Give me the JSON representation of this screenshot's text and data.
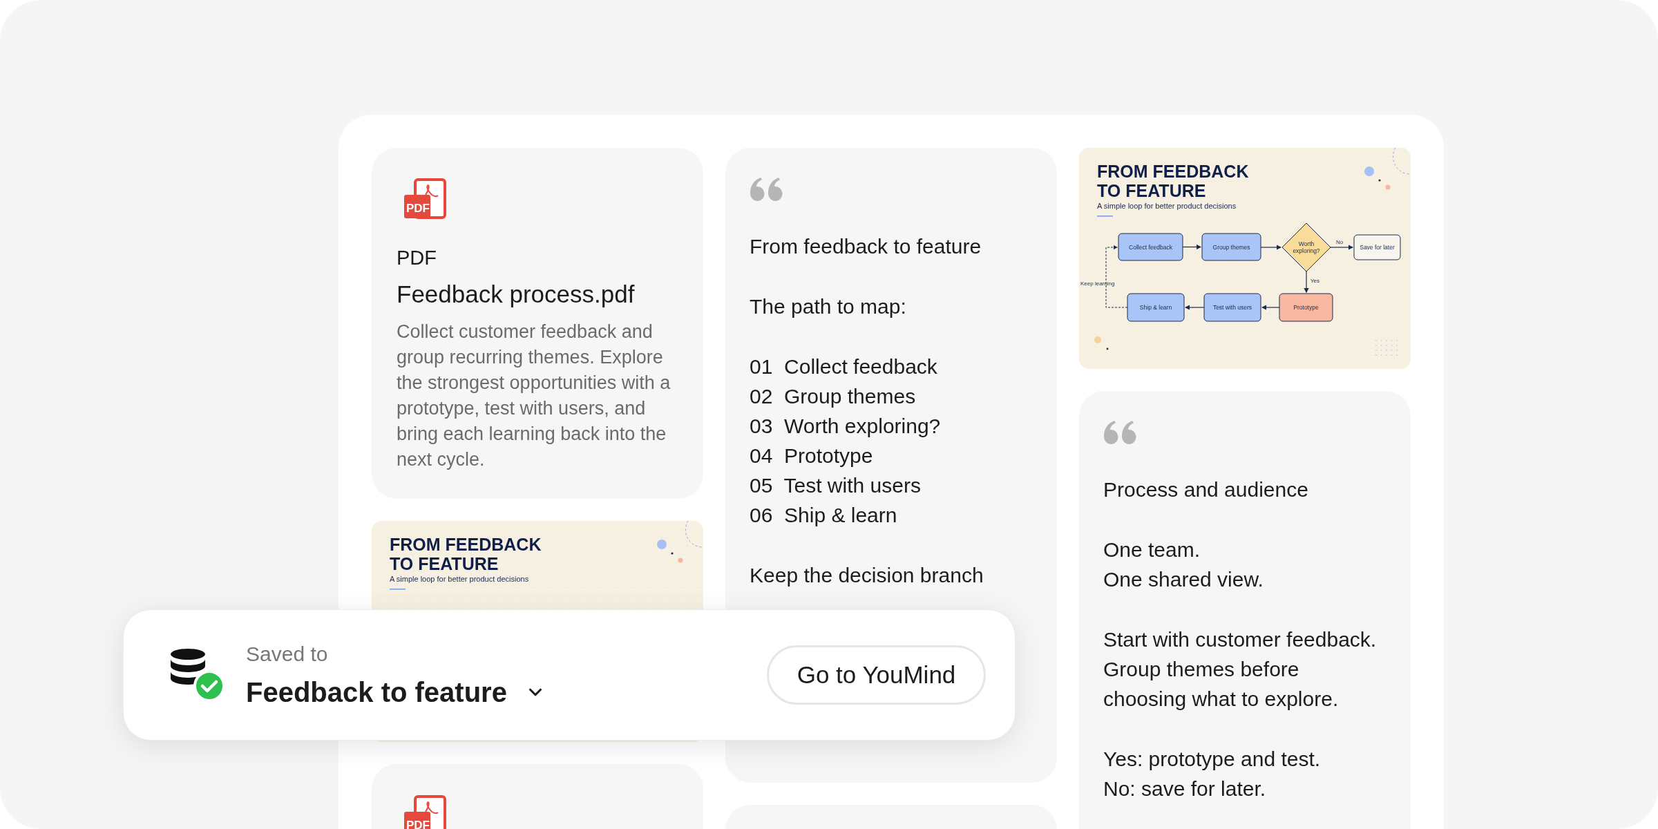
{
  "columns": [
    {
      "cards": [
        {
          "kind": "file",
          "icon_label": "PDF",
          "type_label": "PDF",
          "title": "Feedback process.pdf",
          "description": "Collect customer feedback and group recurring themes. Explore the strongest opportunities with a prototype, test with users, and bring each learning back into the next cycle."
        },
        {
          "kind": "slide",
          "slide": {
            "title_lines": [
              "FROM FEEDBACK",
              "TO FEATURE"
            ],
            "subtitle": "A simple loop for better product decisions"
          }
        },
        {
          "kind": "file",
          "icon_label": "PDF"
        }
      ]
    },
    {
      "cards": [
        {
          "kind": "note",
          "paragraphs": [
            {
              "lines": [
                "From feedback to feature"
              ]
            },
            {
              "lines": [
                "The path to map:"
              ]
            },
            {
              "lines": [
                "01  Collect feedback",
                "02  Group themes",
                "03  Worth exploring?",
                "04  Prototype",
                "05  Test with users",
                "06  Ship & learn"
              ]
            },
            {
              "lines": [
                "Keep the decision branch"
              ]
            }
          ]
        },
        {
          "kind": "blank"
        }
      ]
    },
    {
      "cards": [
        {
          "kind": "slide",
          "slide": {
            "title_lines": [
              "FROM FEEDBACK",
              "TO FEATURE"
            ],
            "subtitle": "A simple loop for better product decisions",
            "nodes": [
              {
                "kind": "step",
                "lines": [
                  "Collect feedback"
                ]
              },
              {
                "kind": "step",
                "lines": [
                  "Group themes"
                ]
              },
              {
                "kind": "decision",
                "lines": [
                  "Worth",
                  "exploring?"
                ]
              },
              {
                "kind": "end",
                "lines": [
                  "Save for later"
                ]
              },
              {
                "kind": "step",
                "lines": [
                  "Ship & learn"
                ]
              },
              {
                "kind": "step",
                "lines": [
                  "Test with users"
                ]
              },
              {
                "kind": "action",
                "lines": [
                  "Prototype"
                ]
              }
            ],
            "edge_labels": [
              "No",
              "Yes",
              "Keep learning"
            ]
          }
        },
        {
          "kind": "note",
          "paragraphs": [
            {
              "lines": [
                "Process and audience"
              ]
            },
            {
              "lines": [
                "One team.",
                "One shared view."
              ]
            },
            {
              "lines": [
                "Start with customer feedback. Group themes before choosing what to explore."
              ]
            },
            {
              "lines": [
                "Yes: prototype and test.",
                "No: save for later."
              ]
            }
          ]
        }
      ]
    }
  ],
  "toast": {
    "caption": "Saved to",
    "destination": "Feedback to feature",
    "button": "Go to YouMind"
  }
}
